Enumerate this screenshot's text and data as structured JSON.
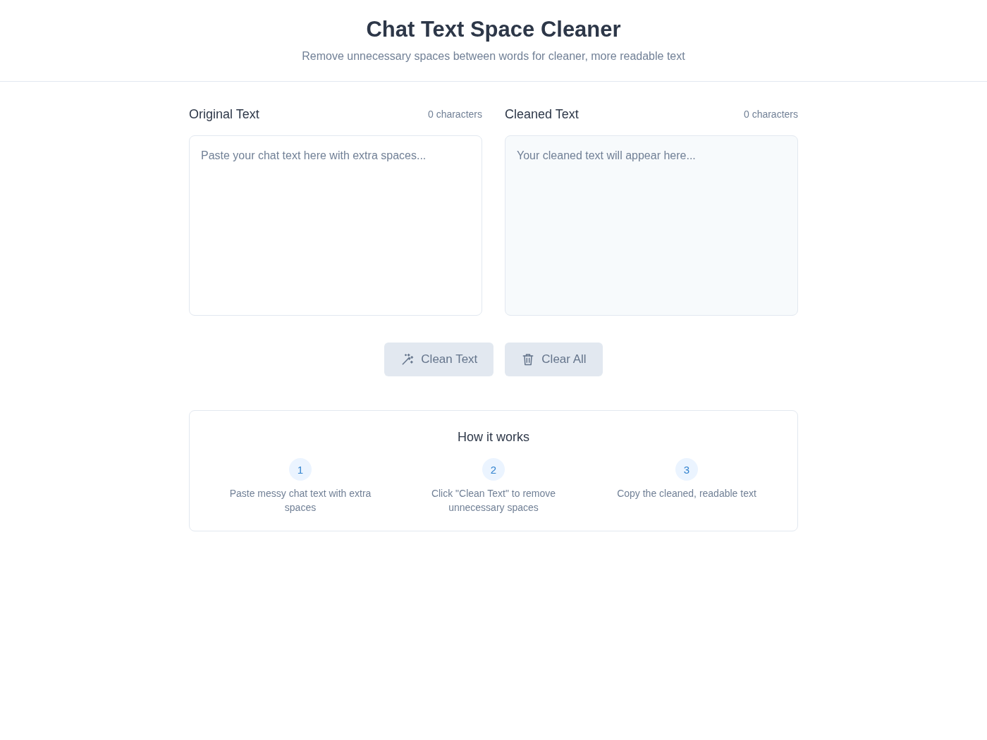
{
  "header": {
    "title": "Chat Text Space Cleaner",
    "subtitle": "Remove unnecessary spaces between words for cleaner, more readable text"
  },
  "panels": [
    {
      "kind": "input",
      "label": "Original Text",
      "count": "0 characters",
      "placeholder": "Paste your chat text here with extra spaces..."
    },
    {
      "kind": "output",
      "label": "Cleaned Text",
      "count": "0 characters",
      "placeholder": "Your cleaned text will appear here..."
    }
  ],
  "actions": [
    {
      "kind": "clean",
      "label": "Clean Text",
      "disabled": true
    },
    {
      "kind": "clear",
      "label": "Clear All",
      "disabled": true
    }
  ],
  "how_it_works": {
    "title": "How it works",
    "steps": [
      {
        "number": "1",
        "text": "Paste messy chat text with extra spaces"
      },
      {
        "number": "2",
        "text": "Click \"Clean Text\" to remove unnecessary spaces"
      },
      {
        "number": "3",
        "text": "Copy the cleaned, readable text"
      }
    ]
  }
}
